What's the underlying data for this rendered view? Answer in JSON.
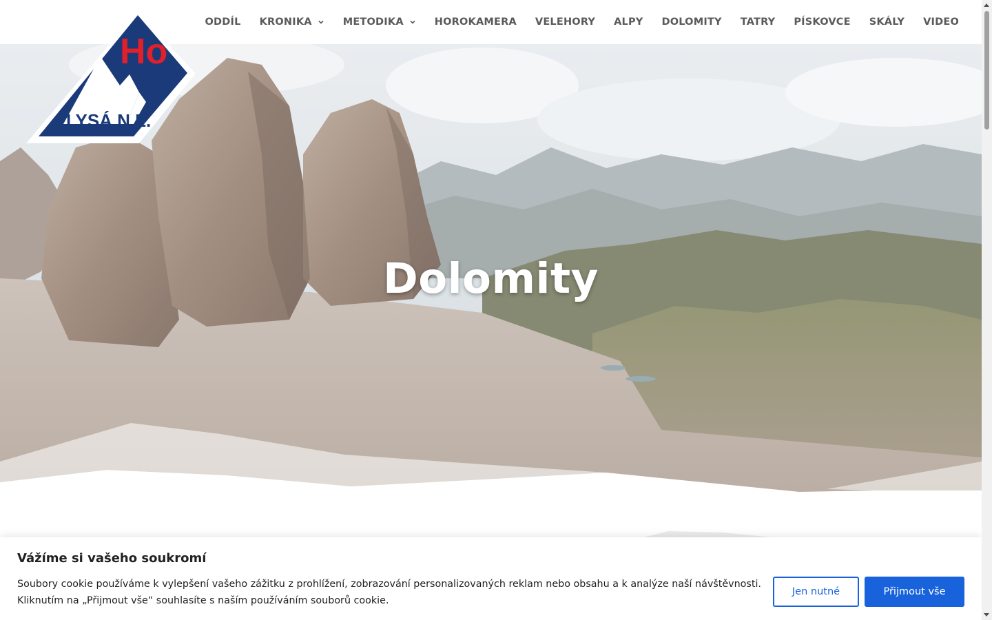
{
  "logo": {
    "initials": "Ho",
    "place": "LYSÁ N.L."
  },
  "nav": {
    "items": [
      {
        "label": "ODDÍL"
      },
      {
        "label": "KRONIKA"
      },
      {
        "label": "METODIKA"
      },
      {
        "label": "HOROKAMERA"
      },
      {
        "label": "VELEHORY"
      },
      {
        "label": "ALPY"
      },
      {
        "label": "DOLOMITY"
      },
      {
        "label": "TATRY"
      },
      {
        "label": "PÍSKOVCE"
      },
      {
        "label": "SKÁLY"
      },
      {
        "label": "VIDEO"
      }
    ]
  },
  "hero": {
    "title": "Dolomity"
  },
  "cookie": {
    "title": "Vážíme si vašeho soukromí",
    "text_line1": "Soubory cookie používáme k vylepšení vašeho zážitku z prohlížení, zobrazování personalizovaných reklam nebo obsahu a k analýze naší návštěvnosti.",
    "text_line2": "Kliknutím na „Přijmout vše“ souhlasíte s naším používáním souborů cookie.",
    "necessary_label": "Jen nutné",
    "accept_label": "Přijmout vše"
  },
  "colors": {
    "brand_blue": "#1a3a7a",
    "brand_red": "#e0202a",
    "accent_button": "#1863dc",
    "nav_text": "#5a5a5a"
  }
}
